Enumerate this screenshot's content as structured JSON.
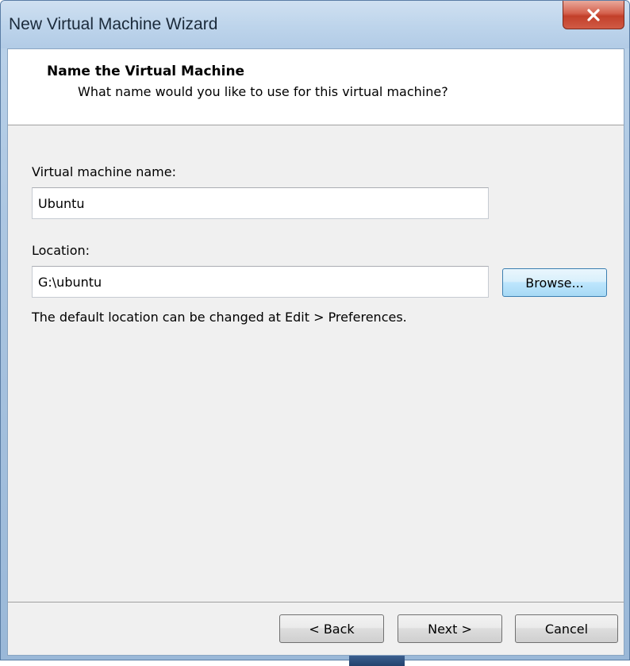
{
  "window": {
    "title": "New Virtual Machine Wizard",
    "close_label": "✕"
  },
  "header": {
    "title": "Name the Virtual Machine",
    "subtitle": "What name would you like to use for this virtual machine?"
  },
  "form": {
    "vm_name_label": "Virtual machine name:",
    "vm_name_value": "Ubuntu",
    "location_label": "Location:",
    "location_value": "G:\\ubuntu",
    "browse_label": "Browse...",
    "hint": "The default location can be changed at Edit > Preferences."
  },
  "footer": {
    "back_label": "< Back",
    "next_label": "Next >",
    "cancel_label": "Cancel"
  },
  "colors": {
    "close_button": "#c2402a",
    "focus_button": "#3c7fb1",
    "panel": "#f0f0f0"
  }
}
